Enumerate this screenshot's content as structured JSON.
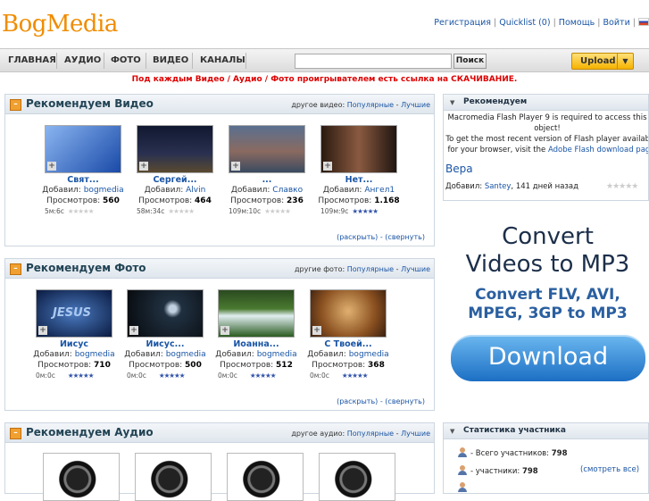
{
  "logo": "BogMedia",
  "toplinks": {
    "register": "Регистрация",
    "sep1": " | ",
    "quicklist": "Quicklist (0)",
    "sep2": " | ",
    "help": "Помощь",
    "sep3": " | ",
    "login": "Войти",
    "sep4": " | "
  },
  "nav": {
    "items": [
      "ГЛАВНАЯ",
      "АУДИО",
      "ФОТО",
      "ВИДЕО",
      "КАНАЛЫ"
    ],
    "search_button": "Поиск",
    "search_value": "",
    "upload": "Upload"
  },
  "notice": "Под каждым Видео / Аудио / Фото проигрывателем есть ссылка на СКАЧИВАНИЕ.",
  "video_panel": {
    "title": "Рекомендуем Видео",
    "other_label": "другое видео:",
    "popular": "Популярные",
    "sep": " - ",
    "best": "Лучшие",
    "items": [
      {
        "title": "Свят...",
        "by_label": "Добавил:",
        "by": "bogmedia",
        "views_label": "Просмотров:",
        "views": "560",
        "duration": "5м:6с",
        "stars": "★★★★★"
      },
      {
        "title": "Сергей...",
        "by_label": "Добавил:",
        "by": "Alvin",
        "views_label": "Просмотров:",
        "views": "464",
        "duration": "58м:34с",
        "stars": "★★★★★"
      },
      {
        "title": "...",
        "by_label": "Добавил:",
        "by": "Славко",
        "views_label": "Просмотров:",
        "views": "236",
        "duration": "109м:10с",
        "stars": "★★★★★"
      },
      {
        "title": "Нет...",
        "by_label": "Добавил:",
        "by": "Ангел1",
        "views_label": "Просмотров:",
        "views": "1.168",
        "duration": "109м:9с",
        "stars": "★★★★★"
      }
    ],
    "expand": "(раскрыть)",
    "dash": " - ",
    "collapse": "(свернуть)"
  },
  "photo_panel": {
    "title": "Рекомендуем Фото",
    "other_label": "другие фото:",
    "popular": "Популярные",
    "sep": " - ",
    "best": "Лучшие",
    "items": [
      {
        "title": "Иисус",
        "by_label": "Добавил:",
        "by": "bogmedia",
        "views_label": "Просмотров:",
        "views": "710",
        "duration": "0м:0с",
        "stars": "★★★★★",
        "thumb_text": "JESUS"
      },
      {
        "title": "Иисус...",
        "by_label": "Добавил:",
        "by": "bogmedia",
        "views_label": "Просмотров:",
        "views": "500",
        "duration": "0м:0с",
        "stars": "★★★★★",
        "thumb_text": ""
      },
      {
        "title": "Иоанна...",
        "by_label": "Добавил:",
        "by": "bogmedia",
        "views_label": "Просмотров:",
        "views": "512",
        "duration": "0м:0с",
        "stars": "★★★★★",
        "thumb_text": ""
      },
      {
        "title": "С Твоей...",
        "by_label": "Добавил:",
        "by": "bogmedia",
        "views_label": "Просмотров:",
        "views": "368",
        "duration": "0м:0с",
        "stars": "★★★★★",
        "thumb_text": ""
      }
    ],
    "expand": "(раскрыть)",
    "dash": " - ",
    "collapse": "(свернуть)"
  },
  "audio_panel": {
    "title": "Рекомендуем Аудио",
    "other_label": "другое аудио:",
    "popular": "Популярные",
    "sep": " - ",
    "best": "Лучшие"
  },
  "side_recommend": {
    "title": "Рекомендуем",
    "flash_line1": "Macromedia Flash Player 9 is required to access this object!",
    "flash_line2": "To get the most recent version of Flash player available for your browser, visit the",
    "flash_link": "Adobe Flash download page",
    "item_title": "Вера",
    "by_label": "Добавил:",
    "by": "Santey",
    "ago": ", 141 дней назад"
  },
  "ad": {
    "line1": "Convert",
    "line2": "Videos to MP3",
    "line3": "Convert FLV, AVI,",
    "line4": "MPEG, 3GP to MP3",
    "button": "Download"
  },
  "stats": {
    "title": "Статистика участника",
    "total_label": "- Всего участников:",
    "total": "798",
    "members_label": "- участники:",
    "members": "798",
    "see_all": "(смотреть все)"
  }
}
